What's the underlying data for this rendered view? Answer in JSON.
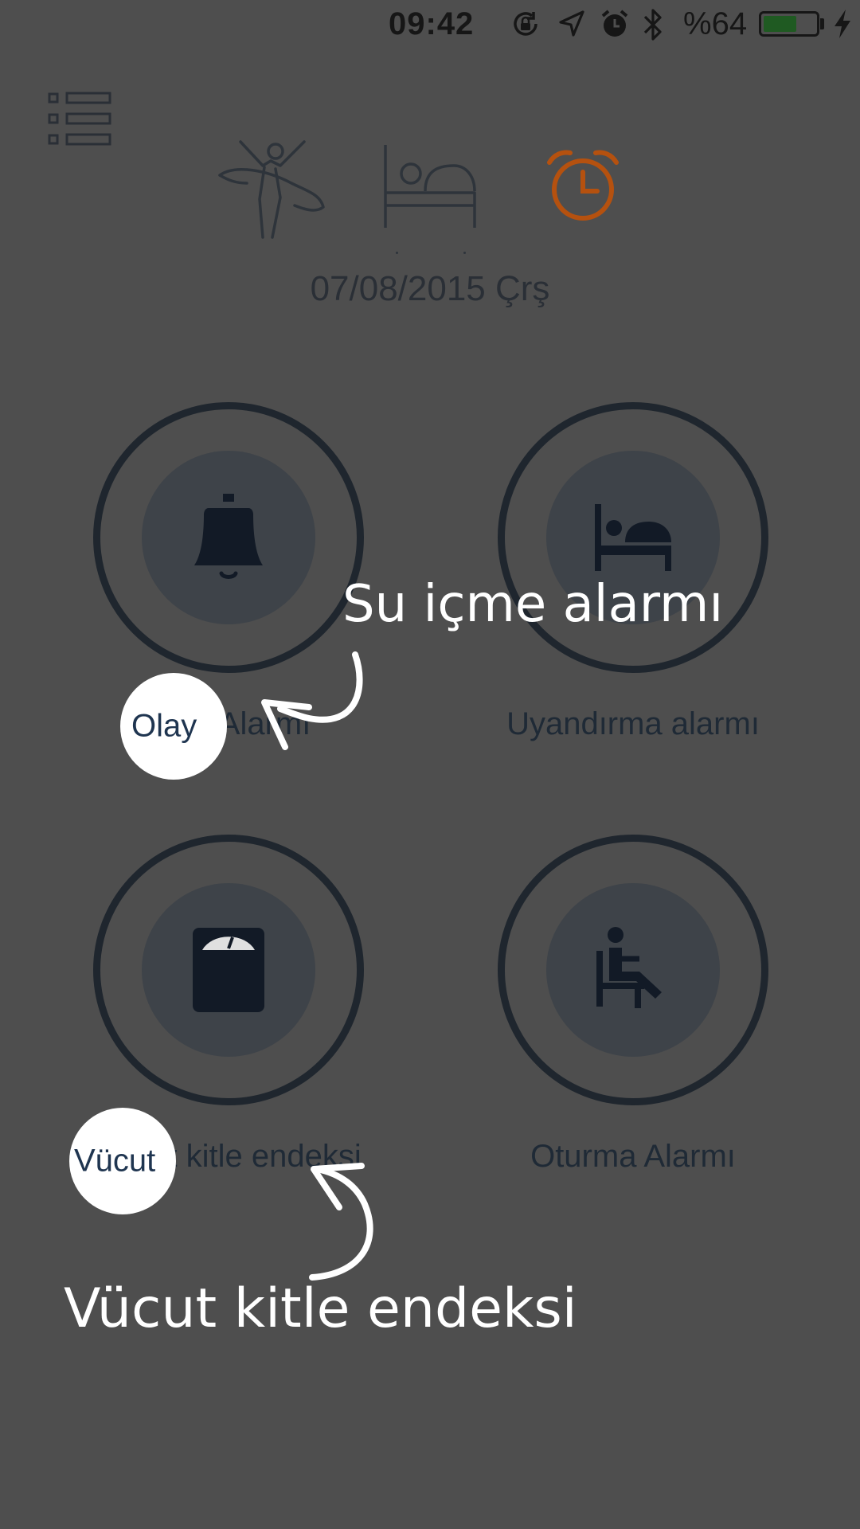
{
  "status_bar": {
    "time": "09:42",
    "battery_percent": "%64",
    "battery_level": 0.64,
    "icons": [
      "rotation-lock-icon",
      "location-arrow-icon",
      "alarm-clock-icon",
      "bluetooth-icon",
      "battery-icon",
      "charging-bolt-icon"
    ]
  },
  "header": {
    "menu_icon": "list-menu-icon",
    "modes": [
      {
        "name": "activity-runner-icon",
        "active": false
      },
      {
        "name": "sleep-bed-icon",
        "active": false
      },
      {
        "name": "alarm-clock-icon",
        "active": true
      }
    ],
    "date": "07/08/2015 Çrş"
  },
  "tiles": [
    {
      "icon": "bell-icon",
      "label": "Olay Alarmı"
    },
    {
      "icon": "bed-icon",
      "label": "Uyandırma alarmı"
    },
    {
      "icon": "scale-icon",
      "label": "Vücut kitle endeksi"
    },
    {
      "icon": "sitting-person-icon",
      "label": "Oturma Alarmı"
    }
  ],
  "tutorial": {
    "spot1_text": "Olay",
    "spot2_text": "Vücut",
    "hint1": "Su içme alarmı",
    "hint2": "Vücut kitle endeksi"
  },
  "colors": {
    "overlay": "#4e4e4e",
    "accent_orange": "#b5510f",
    "ring": "#1f262e",
    "spotlight": "#ffffff"
  }
}
